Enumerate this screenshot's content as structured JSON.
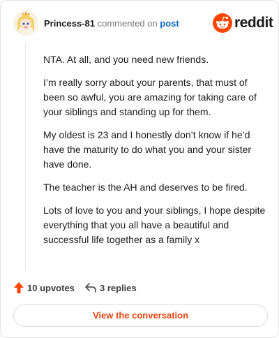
{
  "header": {
    "username": "Princess-81",
    "verb": "commented on",
    "post_link": "post",
    "brand_name": "reddit"
  },
  "comment": {
    "paragraphs": [
      "NTA. At all, and you need new friends.",
      "I’m really sorry about your parents, that must of been so awful, you are amazing for taking care of your siblings and standing up for them.",
      "My oldest is 23 and I honestly don’t know if he’d have the maturity to do what you and your sister have done.",
      "The teacher is the AH and deserves to be fired.",
      "Lots of love to you and your siblings, I hope despite everything that you all have a beautiful and successful life together as a family x"
    ]
  },
  "actions": {
    "upvotes": "10 upvotes",
    "replies": "3 replies"
  },
  "cta": {
    "label": "View the conversation"
  },
  "colors": {
    "accent": "#ff4500",
    "link": "#0b66c3",
    "cta_text": "#e0420f"
  },
  "icons": {
    "upvote": "arrow-up-icon",
    "reply": "reply-arrow-icon",
    "brand": "reddit-snoo-icon"
  }
}
